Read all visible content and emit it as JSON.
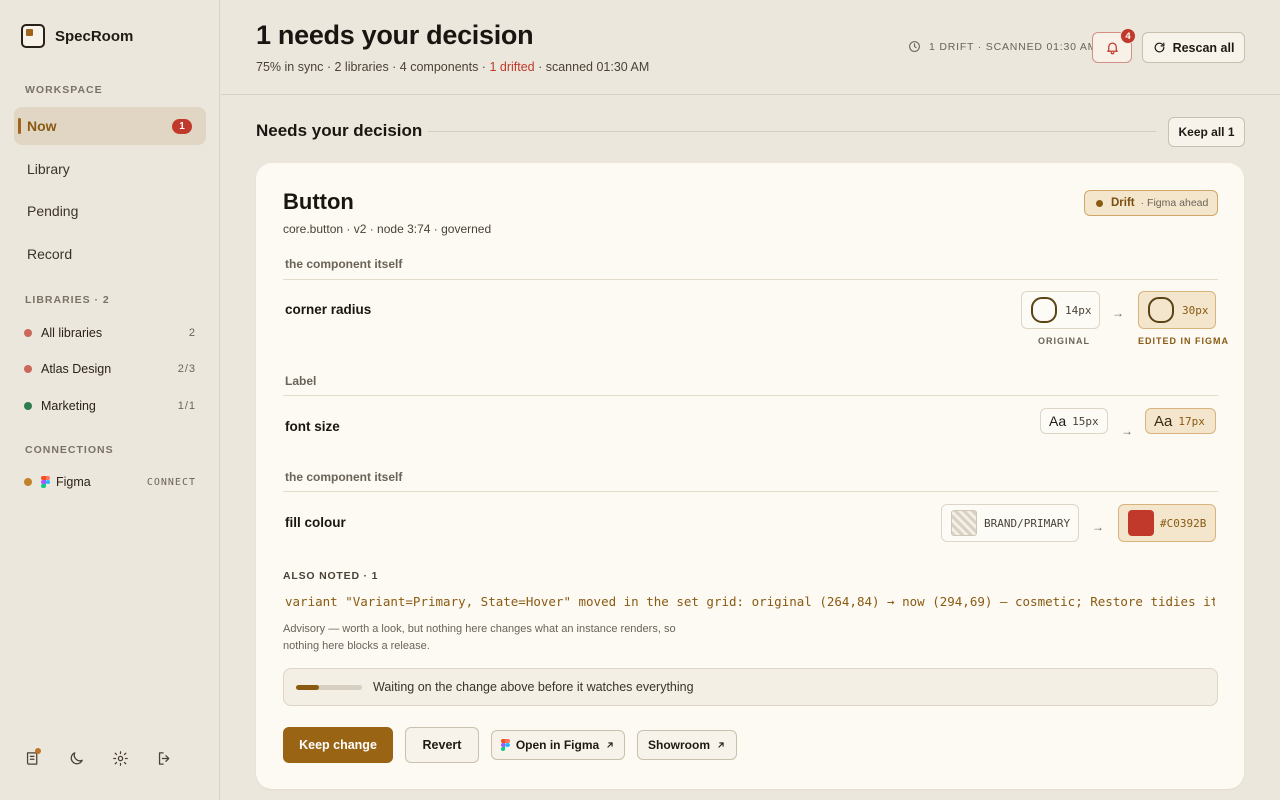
{
  "app": {
    "name": "SpecRoom"
  },
  "sidebar": {
    "workspace_label": "WORKSPACE",
    "nav": [
      {
        "label": "Now",
        "badge": "1",
        "active": true
      },
      {
        "label": "Library"
      },
      {
        "label": "Pending"
      },
      {
        "label": "Record"
      }
    ],
    "libraries_label": "LIBRARIES · 2",
    "libraries": [
      {
        "label": "All libraries",
        "count": "2",
        "color": "#c9685b"
      },
      {
        "label": "Atlas Design",
        "count": "2/3",
        "color": "#c9685b"
      },
      {
        "label": "Marketing",
        "count": "1/1",
        "color": "#2e7d4f"
      }
    ],
    "connections_label": "CONNECTIONS",
    "connections": [
      {
        "label": "Figma",
        "action": "CONNECT",
        "color": "#c0832b"
      }
    ]
  },
  "header": {
    "title": "1 needs your decision",
    "sub_prefix": "75% in sync · 2 libraries · 4 components · ",
    "sub_drift": "1 drifted",
    "sub_suffix": " · scanned 01:30 AM",
    "scan_status": "1 DRIFT · SCANNED 01:30 AM",
    "notifications_count": "4",
    "rescan_label": "Rescan all"
  },
  "section": {
    "title": "Needs your decision",
    "keep_all_label": "Keep all 1"
  },
  "card": {
    "component_name": "Button",
    "component_meta": "core.button · v2 · node 3:74 · governed",
    "drift_label": "Drift",
    "drift_sub": "· Figma ahead",
    "groups": [
      {
        "label": "the component itself",
        "property": "corner radius",
        "original": "14px",
        "edited": "30px",
        "original_caption": "ORIGINAL",
        "edited_caption": "EDITED IN FIGMA"
      },
      {
        "label": "Label",
        "property": "font size",
        "glyph": "Aa",
        "original": "15px",
        "edited": "17px"
      },
      {
        "label": "the component itself",
        "property": "fill colour",
        "original": "BRAND/PRIMARY",
        "edited": "#C0392B"
      }
    ],
    "also_noted_label": "ALSO NOTED · 1",
    "noted_line": "variant \"Variant=Primary, State=Hover\" moved in the set grid: original (264,84) → now (294,69) — cosmetic; Restore tidies it",
    "advisory": "Advisory — worth a look, but nothing here changes what an instance renders, so nothing here blocks a release.",
    "waiting_progress": 0.35,
    "waiting_text": "Waiting on the change above before it watches everything",
    "actions": {
      "keep": "Keep change",
      "revert": "Revert",
      "open_figma": "Open in Figma",
      "showroom": "Showroom"
    }
  },
  "colors": {
    "accent": "#9a6415",
    "drift_red": "#c0392b",
    "edited_fill": "#C0392B"
  },
  "icons": [
    "clock-icon",
    "bell-icon",
    "refresh-icon",
    "arrow-right-icon",
    "external-link-icon",
    "figma-icon",
    "book-icon",
    "moon-icon",
    "gear-icon",
    "logout-icon"
  ]
}
